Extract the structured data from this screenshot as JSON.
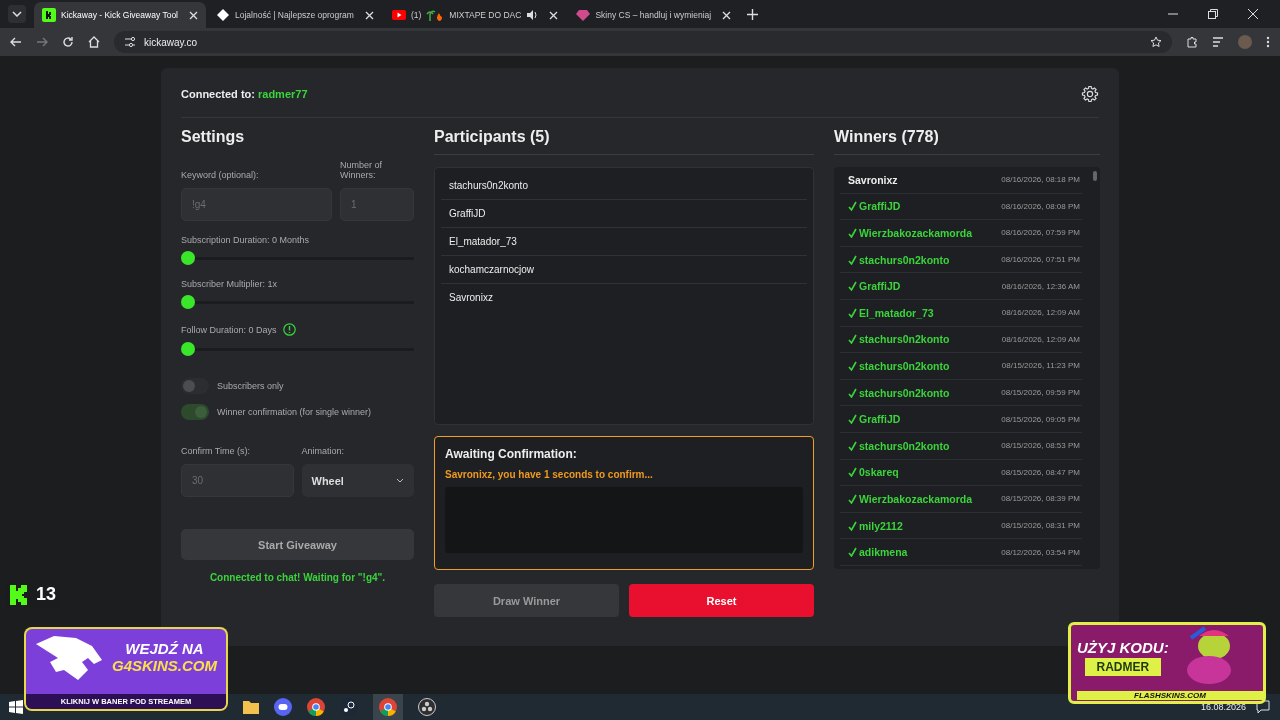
{
  "browser": {
    "tabs": [
      {
        "title": "Kickaway - Kick Giveaway Tool",
        "selected": true,
        "audio": false
      },
      {
        "title": "Lojalność | Najlepsze oprogram",
        "selected": false,
        "audio": false
      },
      {
        "prefix": "(1)",
        "title": "MIXTAPE DO DAC",
        "selected": false,
        "audio": true
      },
      {
        "title": "Skiny CS – handluj i wymieniaj",
        "selected": false,
        "audio": false
      }
    ],
    "address": "kickaway.co"
  },
  "header": {
    "label": "Connected to:",
    "channel": "radmer77"
  },
  "settings": {
    "title": "Settings",
    "keyword_label": "Keyword (optional):",
    "keyword_placeholder": "!g4",
    "winners_label": "Number of Winners:",
    "winners_placeholder": "1",
    "sliders": [
      {
        "label": "Subscription Duration: 0 Months",
        "level": 0,
        "info": false
      },
      {
        "label": "Subscriber Multiplier: 1x",
        "level": 0,
        "info": false
      },
      {
        "label": "Follow Duration:  0  Days",
        "level": 0,
        "info": true
      }
    ],
    "toggles": [
      {
        "label": "Subscribers only",
        "on": false
      },
      {
        "label": "Winner confirmation (for single winner)",
        "on": true
      }
    ],
    "confirm_label": "Confirm Time (s):",
    "confirm_placeholder": "30",
    "animation_label": "Animation:",
    "animation_value": "Wheel",
    "start_button": "Start Giveaway",
    "status": "Connected to chat! Waiting for \"!g4\"."
  },
  "participants": {
    "title": "Participants (5)",
    "items": [
      "stachurs0n2konto",
      "GraffiJD",
      "El_matador_73",
      "kochamczarnocjow",
      "Savronixz"
    ]
  },
  "awaiting": {
    "title": "Awaiting Confirmation:",
    "message": "Savronixz, you have 1 seconds to confirm..."
  },
  "draw_button": "Draw Winner",
  "reset_button": "Reset",
  "winners": {
    "title": "Winners (778)",
    "rows": [
      {
        "name": "Savronixz",
        "time": "08/16/2026, 08:18 PM",
        "confirmed": false
      },
      {
        "name": "GraffiJD",
        "time": "08/16/2026, 08:08 PM",
        "confirmed": true
      },
      {
        "name": "Wierzbakozackamorda",
        "time": "08/16/2026, 07:59 PM",
        "confirmed": true
      },
      {
        "name": "stachurs0n2konto",
        "time": "08/16/2026, 07:51 PM",
        "confirmed": true
      },
      {
        "name": "GraffiJD",
        "time": "08/16/2026, 12:36 AM",
        "confirmed": true
      },
      {
        "name": "El_matador_73",
        "time": "08/16/2026, 12:09 AM",
        "confirmed": true
      },
      {
        "name": "stachurs0n2konto",
        "time": "08/16/2026, 12:09 AM",
        "confirmed": true
      },
      {
        "name": "stachurs0n2konto",
        "time": "08/15/2026, 11:23 PM",
        "confirmed": true
      },
      {
        "name": "stachurs0n2konto",
        "time": "08/15/2026, 09:59 PM",
        "confirmed": true
      },
      {
        "name": "GraffiJD",
        "time": "08/15/2026, 09:05 PM",
        "confirmed": true
      },
      {
        "name": "stachurs0n2konto",
        "time": "08/15/2026, 08:53 PM",
        "confirmed": true
      },
      {
        "name": "0skareq",
        "time": "08/15/2026, 08:47 PM",
        "confirmed": true
      },
      {
        "name": "Wierzbakozackamorda",
        "time": "08/15/2026, 08:39 PM",
        "confirmed": true
      },
      {
        "name": "mily2112",
        "time": "08/15/2026, 08:31 PM",
        "confirmed": true
      },
      {
        "name": "adikmena",
        "time": "08/12/2026, 03:54 PM",
        "confirmed": true
      }
    ]
  },
  "overlay": {
    "viewer_count": "13",
    "left_banner": {
      "headline": "WEJDŹ NA",
      "site": "G4SKINS.COM",
      "footer": "KLIKNIJ W BANER POD STREAMEM"
    },
    "right_banner": {
      "headline": "UŻYJ KODU:",
      "code": "RADMER",
      "site": "FLASHSKINS.COM"
    }
  },
  "taskbar": {
    "date": "16.08.2026"
  }
}
